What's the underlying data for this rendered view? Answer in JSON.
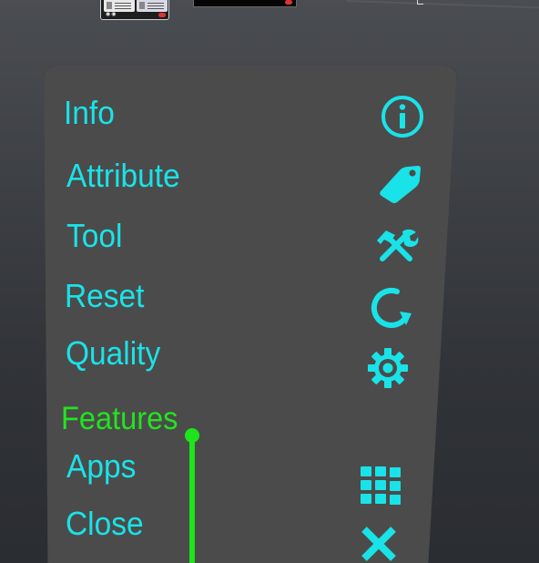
{
  "colors": {
    "accent": "#19e3e8",
    "section_heading": "#22e41e",
    "panel": "#4b4b4b"
  },
  "thumbnails": {
    "card_icons": [
      "eye-icon",
      "eye-icon"
    ]
  },
  "menu": {
    "items": [
      {
        "label": "Info",
        "icon": "info-icon"
      },
      {
        "label": "Attribute",
        "icon": "tag-icon"
      },
      {
        "label": "Tool",
        "icon": "tools-icon"
      },
      {
        "label": "Reset",
        "icon": "reset-icon"
      },
      {
        "label": "Quality",
        "icon": "gear-icon"
      }
    ],
    "section_heading": "Features",
    "feature_items": [
      {
        "label": "Apps",
        "icon": "grid-icon"
      },
      {
        "label": "Close",
        "icon": "close-icon"
      }
    ]
  }
}
